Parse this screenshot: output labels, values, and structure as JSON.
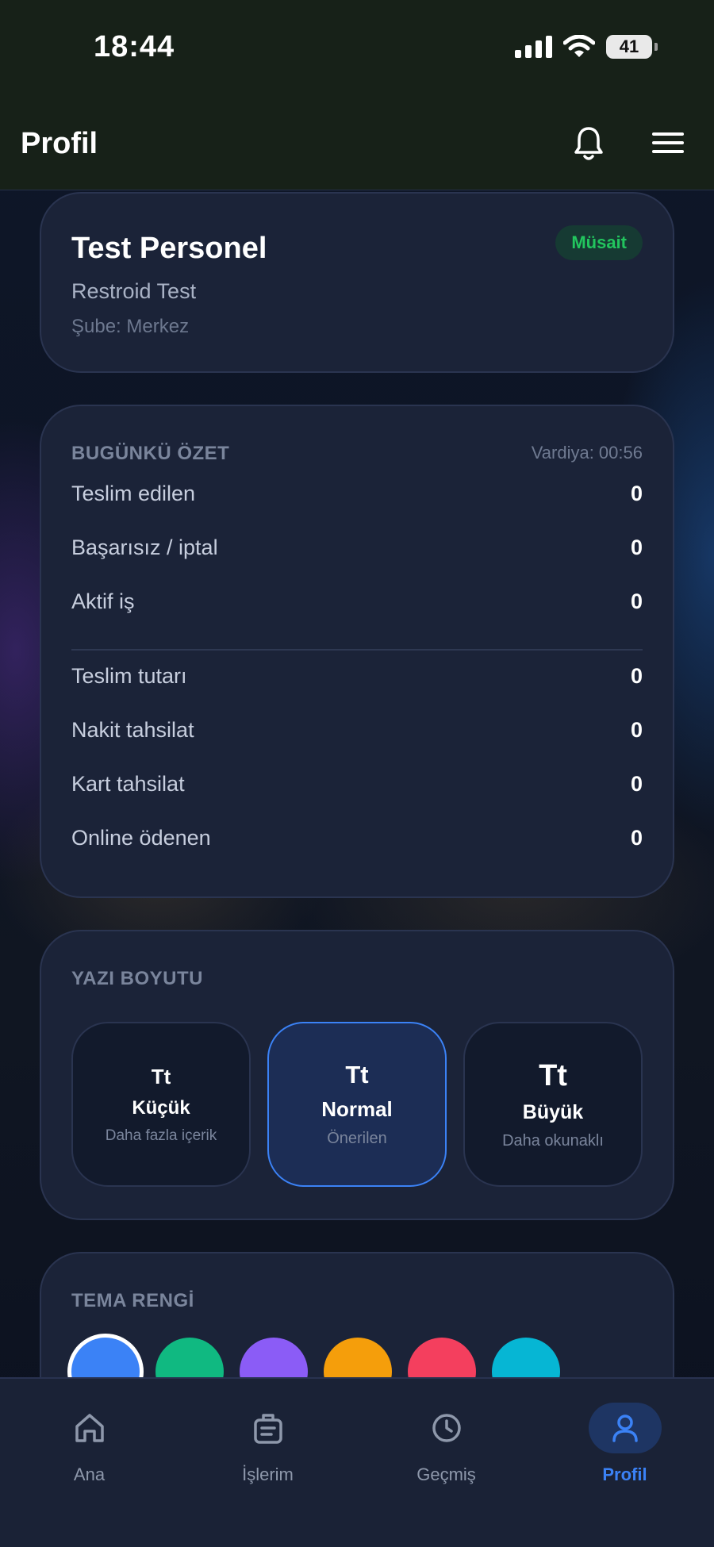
{
  "status_bar": {
    "time": "18:44",
    "battery": "41"
  },
  "header": {
    "title": "Profil"
  },
  "profile": {
    "name": "Test Personel",
    "company": "Restroid Test",
    "branch": "Şube: Merkez",
    "status": "Müsait"
  },
  "summary": {
    "title": "BUGÜNKÜ ÖZET",
    "shift": "Vardiya: 00:56",
    "rows_top": [
      {
        "label": "Teslim edilen",
        "value": "0"
      },
      {
        "label": "Başarısız / iptal",
        "value": "0"
      },
      {
        "label": "Aktif iş",
        "value": "0"
      }
    ],
    "rows_bottom": [
      {
        "label": "Teslim tutarı",
        "value": "0"
      },
      {
        "label": "Nakit tahsilat",
        "value": "0"
      },
      {
        "label": "Kart tahsilat",
        "value": "0"
      },
      {
        "label": "Online ödenen",
        "value": "0"
      }
    ]
  },
  "font_size": {
    "title": "YAZI BOYUTU",
    "options": [
      {
        "glyph": "Tt",
        "name": "Küçük",
        "desc": "Daha fazla içerik"
      },
      {
        "glyph": "Tt",
        "name": "Normal",
        "desc": "Önerilen"
      },
      {
        "glyph": "Tt",
        "name": "Büyük",
        "desc": "Daha okunaklı"
      }
    ],
    "selected": "Normal"
  },
  "theme": {
    "title": "TEMA RENGİ",
    "colors": [
      "#3b82f6",
      "#10b981",
      "#8b5cf6",
      "#f59e0b",
      "#f43f5e",
      "#06b6d4"
    ],
    "selected": "#3b82f6"
  },
  "nav": {
    "items": [
      {
        "label": "Ana",
        "icon": "home-icon"
      },
      {
        "label": "İşlerim",
        "icon": "clipboard-icon"
      },
      {
        "label": "Geçmiş",
        "icon": "clock-icon"
      },
      {
        "label": "Profil",
        "icon": "user-icon"
      }
    ],
    "active": "Profil",
    "active_color": "#3b82f6"
  }
}
